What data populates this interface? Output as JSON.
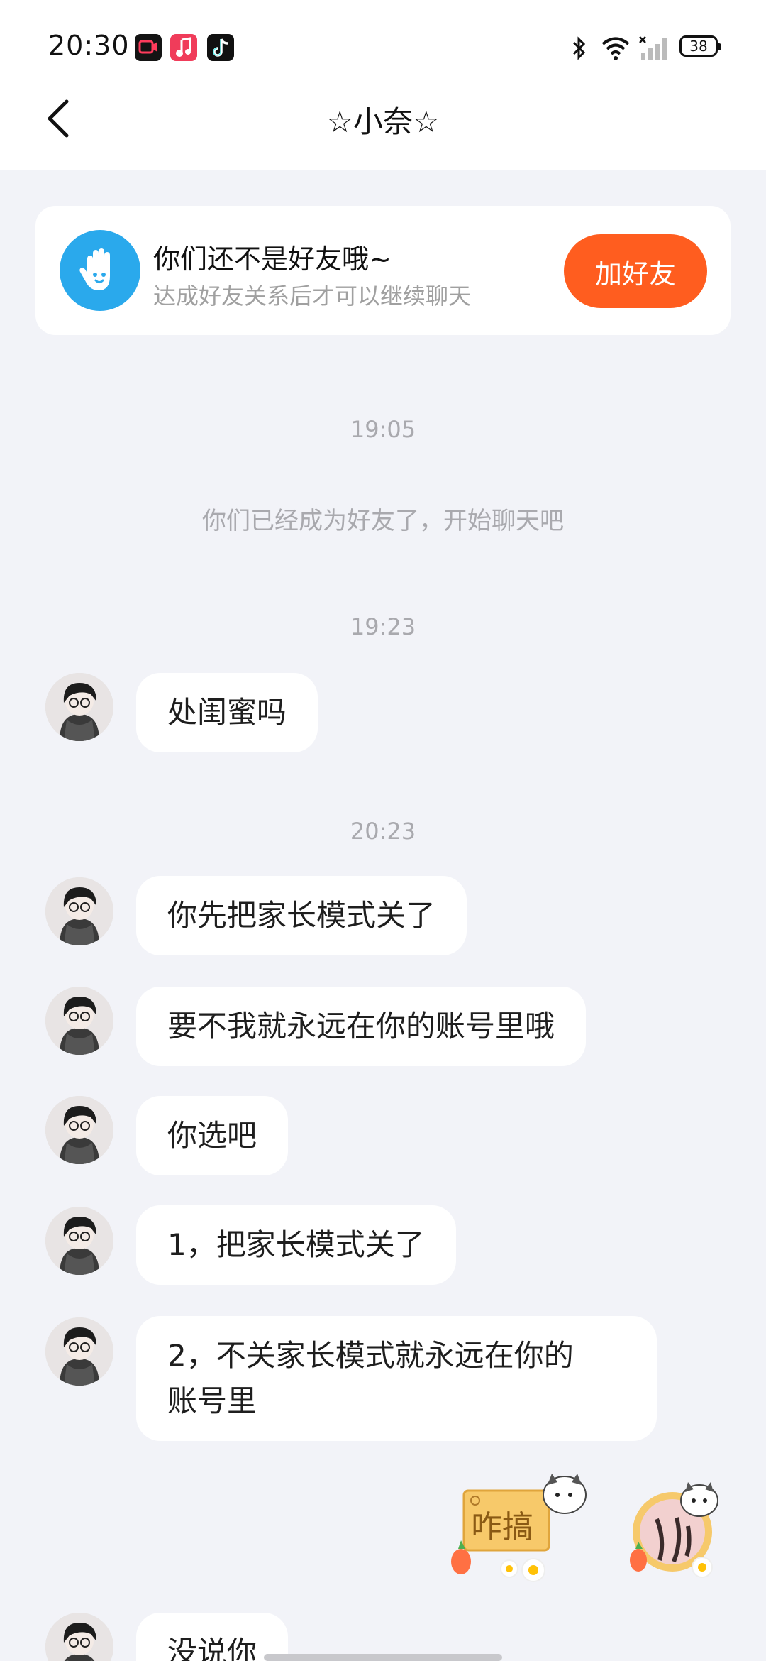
{
  "status_bar": {
    "time": "20:30",
    "apps": [
      "video-recorder-icon",
      "music-icon",
      "tiktok-icon"
    ],
    "battery": "38"
  },
  "header": {
    "back_icon": "chevron-left-icon",
    "title": "☆小奈☆"
  },
  "friend_card": {
    "title": "你们还不是好友哦~",
    "subtitle": "达成好友关系后才可以继续聊天",
    "button": "加好友",
    "accent": "#ff5d1f",
    "badge_color": "#2aa9ec"
  },
  "chat": {
    "time1": "19:05",
    "system": "你们已经成为好友了，开始聊天吧",
    "time2": "19:23",
    "msg1": "处闺蜜吗",
    "time3": "20:23",
    "msg2": "你先把家长模式关了",
    "msg3": "要不我就永远在你的账号里哦",
    "msg4": "你选吧",
    "msg5": "1，把家长模式关了",
    "msg6_line1": "2，不关家长模式就永远在你的",
    "msg6_line2": "账号里",
    "sticker1_text": "咋搞",
    "msg7": "没说你"
  }
}
